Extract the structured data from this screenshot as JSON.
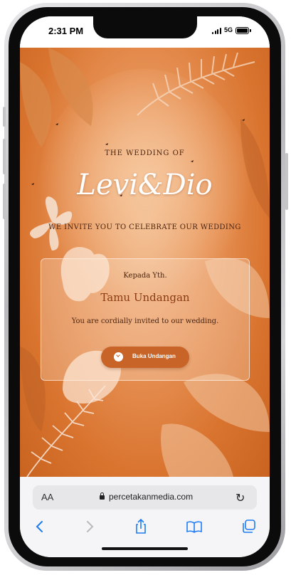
{
  "status": {
    "time": "2:31 PM",
    "network": "5G"
  },
  "invitation": {
    "header": "THE WEDDING OF",
    "couple": "Levi&Dio",
    "invite_line": "WE INVITE YOU TO CELEBRATE OUR WEDDING",
    "card": {
      "recipient_prefix": "Kepada Yth.",
      "recipient_name": "Tamu Undangan",
      "message": "You are cordially invited to our wedding.",
      "button_label": "Buka Undangan"
    }
  },
  "browser": {
    "text_size_label": "AA",
    "url": "percetakanmedia.com",
    "icons": [
      "lock-icon",
      "reload-icon",
      "back-icon",
      "forward-icon",
      "share-icon",
      "bookmarks-icon",
      "tabs-icon"
    ]
  },
  "colors": {
    "accent": "#c86428",
    "background": "#e8955a",
    "title_text": "#4a2410",
    "guest_text": "#8a3a10"
  }
}
